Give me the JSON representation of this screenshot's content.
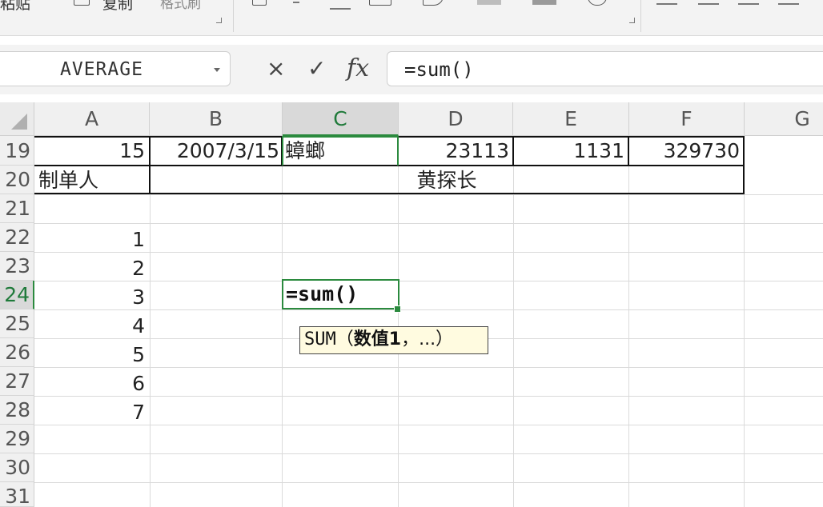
{
  "ribbon": {
    "paste_label": "粘贴",
    "copy_label": "复制",
    "format_painter_label": "格式刷"
  },
  "formula_bar": {
    "name_box": "AVERAGE",
    "cancel_symbol": "×",
    "enter_symbol": "✓",
    "fx_label": "fx",
    "formula": "=sum()"
  },
  "columns": [
    "A",
    "B",
    "C",
    "D",
    "E",
    "F",
    "G"
  ],
  "selected_column": "C",
  "rows": [
    "19",
    "20",
    "21",
    "22",
    "23",
    "24",
    "25",
    "26",
    "27",
    "28",
    "29",
    "30",
    "31"
  ],
  "selected_row": "24",
  "cells": {
    "A19": "15",
    "B19": "2007/3/15",
    "C19": "蟑螂",
    "D19": "23113",
    "E19": "1131",
    "F19": "329730",
    "A20": "制单人",
    "B20": "黄探长",
    "A22": "1",
    "A23": "2",
    "A24": "3",
    "A25": "4",
    "A26": "5",
    "A27": "6",
    "A28": "7"
  },
  "active_cell": {
    "ref": "C24",
    "content": "=sum()"
  },
  "tooltip": {
    "function": "SUM",
    "open": "（",
    "arg": "数值1",
    "rest": "，...）"
  },
  "colors": {
    "selection": "#2b8a3e",
    "tooltip_bg": "#fffbe0"
  }
}
